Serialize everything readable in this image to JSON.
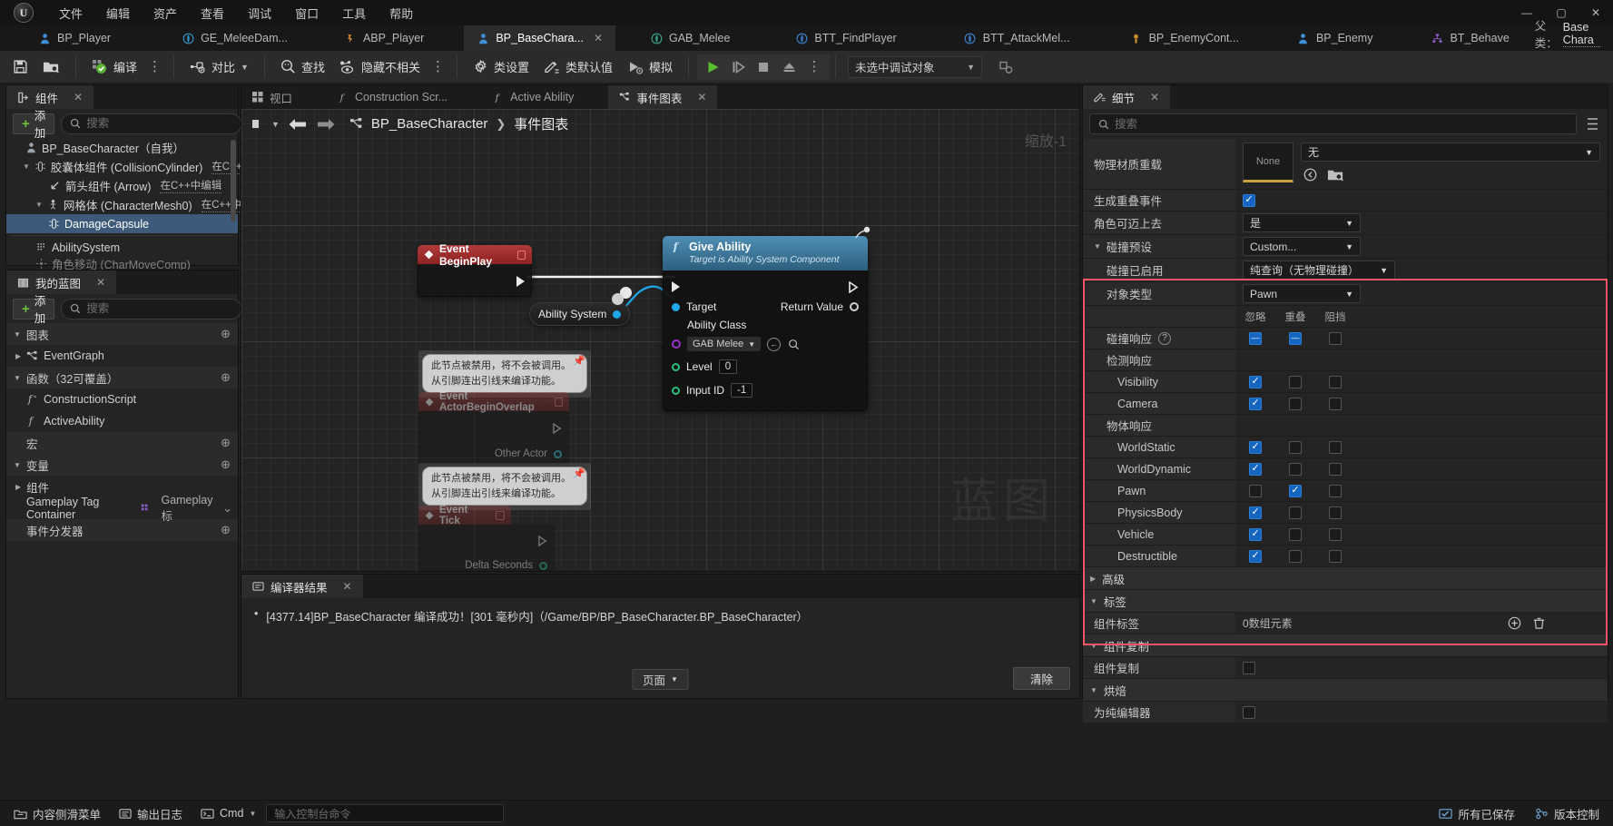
{
  "window": {
    "minimize": "—",
    "maximize": "▢",
    "close": "✕"
  },
  "menu": {
    "items": [
      "文件",
      "编辑",
      "资产",
      "查看",
      "调试",
      "窗口",
      "工具",
      "帮助"
    ]
  },
  "asset_tabs": [
    {
      "label": "BP_Player",
      "icon": "character-icon",
      "active": false
    },
    {
      "label": "GE_MeleeDam...",
      "icon": "gameplay-effect-icon",
      "active": false
    },
    {
      "label": "ABP_Player",
      "icon": "anim-blueprint-icon",
      "active": false
    },
    {
      "label": "BP_BaseChara...",
      "icon": "character-icon",
      "active": true
    },
    {
      "label": "GAB_Melee",
      "icon": "gameplay-ability-icon",
      "active": false
    },
    {
      "label": "BTT_FindPlayer",
      "icon": "bt-task-icon",
      "active": false
    },
    {
      "label": "BTT_AttackMel...",
      "icon": "bt-task-icon",
      "active": false
    },
    {
      "label": "BP_EnemyCont...",
      "icon": "controller-icon",
      "active": false
    },
    {
      "label": "BP_Enemy",
      "icon": "character-icon",
      "active": false
    },
    {
      "label": "BT_Behave",
      "icon": "behavior-tree-icon",
      "active": false
    }
  ],
  "parent_class": {
    "label": "父类：",
    "value": "Base Chara"
  },
  "toolbar": {
    "save": "保存",
    "browse": "浏览",
    "compile": "编译",
    "diff": "对比",
    "find": "查找",
    "hide_unrelated": "隐藏不相关",
    "class_settings": "类设置",
    "class_defaults": "类默认值",
    "simulate": "模拟",
    "play": "播放",
    "step": "步进",
    "stop": "停止",
    "eject": "弹出",
    "debug_object": "未选中调试对象"
  },
  "components_panel": {
    "tab_title": "组件",
    "add_label": "添加",
    "search_placeholder": "搜索",
    "search_value": "",
    "tree": [
      {
        "label": "BP_BaseCharacter（自我）",
        "indent": 0,
        "icon": "character-icon",
        "arrow": "",
        "link": "",
        "selected": false
      },
      {
        "label": "胶囊体组件 (CollisionCylinder)",
        "indent": 1,
        "icon": "capsule-icon",
        "arrow": "▼",
        "link": "在C++中",
        "selected": false
      },
      {
        "label": "箭头组件 (Arrow)",
        "indent": 2,
        "icon": "arrow-icon",
        "arrow": "",
        "link": "在C++中编辑",
        "selected": false
      },
      {
        "label": "网格体 (CharacterMesh0)",
        "indent": 2,
        "icon": "mesh-icon",
        "arrow": "▼",
        "link": "在C++中",
        "selected": false
      },
      {
        "label": "DamageCapsule",
        "indent": 3,
        "icon": "capsule-icon",
        "arrow": "",
        "link": "",
        "selected": true
      },
      {
        "label": "AbilitySystem",
        "indent": 1,
        "icon": "ability-system-icon",
        "arrow": "",
        "link": "",
        "selected": false
      }
    ]
  },
  "myblueprint_panel": {
    "tab_title": "我的蓝图",
    "add_label": "添加",
    "search_placeholder": "搜索",
    "search_value": "",
    "settings_icon": "gear-icon",
    "sections": [
      {
        "type": "section",
        "label": "图表",
        "arrow": "▼",
        "plus": true
      },
      {
        "type": "item",
        "label": "EventGraph",
        "icon": "graph-icon",
        "arrow": "▶"
      },
      {
        "type": "section",
        "label": "函数（32可覆盖）",
        "arrow": "▼",
        "plus": true
      },
      {
        "type": "item",
        "label": "ConstructionScript",
        "icon": "function-icon",
        "arrow": ""
      },
      {
        "type": "item",
        "label": "ActiveAbility",
        "icon": "function-icon",
        "arrow": ""
      },
      {
        "type": "section",
        "label": "宏",
        "arrow": "",
        "plus": true
      },
      {
        "type": "section",
        "label": "变量",
        "arrow": "▼",
        "plus": true
      },
      {
        "type": "item",
        "label": "组件",
        "icon": "",
        "arrow": "▶"
      },
      {
        "type": "var",
        "label": "Gameplay Tag Container",
        "type_label": "Gameplay标",
        "icon": "tag-icon"
      },
      {
        "type": "section",
        "label": "事件分发器",
        "arrow": "",
        "plus": true
      }
    ]
  },
  "graph": {
    "doc_tabs": [
      {
        "label": "视口",
        "icon": "viewport-icon",
        "active": false
      },
      {
        "label": "Construction Scr...",
        "icon": "function-icon",
        "active": false
      },
      {
        "label": "Active Ability",
        "icon": "function-icon",
        "active": false
      },
      {
        "label": "事件图表",
        "icon": "graph-icon",
        "active": true
      }
    ],
    "breadcrumb_root": "BP_BaseCharacter",
    "breadcrumb_sep": "❯",
    "breadcrumb_leaf": "事件图表",
    "zoom_label": "缩放-1",
    "watermark": "蓝图",
    "nodes": {
      "begin_play": {
        "title": "Event BeginPlay"
      },
      "give_ability": {
        "title": "Give Ability",
        "subtitle": "Target is Ability System Component",
        "target_pin": "Target",
        "return_pin": "Return Value",
        "ability_class_label": "Ability Class",
        "ability_class_value": "GAB Melee",
        "level_label": "Level",
        "level_value": "0",
        "input_id_label": "Input ID",
        "input_id_value": "-1"
      },
      "ability_system_var": {
        "label": "Ability System"
      },
      "actor_begin_overlap": {
        "title": "Event ActorBeginOverlap",
        "other_actor_pin": "Other Actor",
        "note": "此节点被禁用，将不会被调用。\n从引脚连出引线来编译功能。"
      },
      "event_tick": {
        "title": "Event Tick",
        "delta_pin": "Delta Seconds",
        "note": "此节点被禁用，将不会被调用。\n从引脚连出引线来编译功能。"
      }
    }
  },
  "compiler_panel": {
    "tab_title": "编译器结果",
    "message": "[4377.14]BP_BaseCharacter 编译成功！[301 毫秒内]（/Game/BP/BP_BaseCharacter.BP_BaseCharacter）",
    "page_label": "页面",
    "clear_label": "清除"
  },
  "details_panel": {
    "tab_title": "细节",
    "search_placeholder": "搜索",
    "search_value": "",
    "physical_material": {
      "label": "物理材质重载",
      "thumb_label": "None",
      "combo_value": "无"
    },
    "rows": [
      {
        "label": "生成重叠事件",
        "indent": 0,
        "kind": "checkbox",
        "checked": true
      },
      {
        "label": "角色可迈上去",
        "indent": 0,
        "kind": "combo",
        "value": "是"
      },
      {
        "label": "碰撞预设",
        "indent": 0,
        "kind": "combo",
        "value": "Custom...",
        "arrow": "▼"
      },
      {
        "label": "碰撞已启用",
        "indent": 1,
        "kind": "combo",
        "value": "纯查询（无物理碰撞）"
      },
      {
        "label": "对象类型",
        "indent": 1,
        "kind": "combo",
        "value": "Pawn"
      }
    ],
    "collision_columns": [
      "忽略",
      "重叠",
      "阻挡"
    ],
    "collision_response_label": "碰撞响应",
    "collision_response_help": "?",
    "collision_groups": [
      {
        "label": "碰撞响应",
        "indent": 1,
        "kind": "tri",
        "state": "dash"
      },
      {
        "label": "检测响应",
        "indent": 1,
        "kind": "header"
      },
      {
        "label": "Visibility",
        "indent": 2,
        "kind": "radio",
        "selected": 0
      },
      {
        "label": "Camera",
        "indent": 2,
        "kind": "radio",
        "selected": 0
      },
      {
        "label": "物体响应",
        "indent": 1,
        "kind": "header"
      },
      {
        "label": "WorldStatic",
        "indent": 2,
        "kind": "radio",
        "selected": 0
      },
      {
        "label": "WorldDynamic",
        "indent": 2,
        "kind": "radio",
        "selected": 0
      },
      {
        "label": "Pawn",
        "indent": 2,
        "kind": "radio",
        "selected": 1
      },
      {
        "label": "PhysicsBody",
        "indent": 2,
        "kind": "radio",
        "selected": 0
      },
      {
        "label": "Vehicle",
        "indent": 2,
        "kind": "radio",
        "selected": 0
      },
      {
        "label": "Destructible",
        "indent": 2,
        "kind": "radio",
        "selected": 0
      }
    ],
    "sections": [
      {
        "label": "高级",
        "arrow": "▶"
      },
      {
        "label": "标签",
        "arrow": "▼"
      },
      {
        "label": "组件复制",
        "arrow": "▼"
      },
      {
        "label": "烘焙",
        "arrow": "▼"
      }
    ],
    "component_tags": {
      "label": "组件标签",
      "value": "0数组元素",
      "add_icon": "plus-circle-icon",
      "delete_icon": "trash-icon"
    },
    "component_replication": {
      "label": "组件复制",
      "checked": false
    },
    "editor_only": {
      "label": "为纯编辑器",
      "checked": false
    }
  },
  "statusbar": {
    "content_drawer": "内容侧滑菜单",
    "output_log": "输出日志",
    "cmd_label": "Cmd",
    "cmd_placeholder": "输入控制台命令",
    "all_saved": "所有已保存",
    "revision": "版本控制"
  },
  "colors": {
    "accent_blue": "#1fa8e8",
    "selection": "#3d5a7a",
    "event_red": "#8c2222",
    "function_blue": "#2d5f7e",
    "highlight_red": "#ff5566",
    "compile_green": "#6fbf3f"
  }
}
